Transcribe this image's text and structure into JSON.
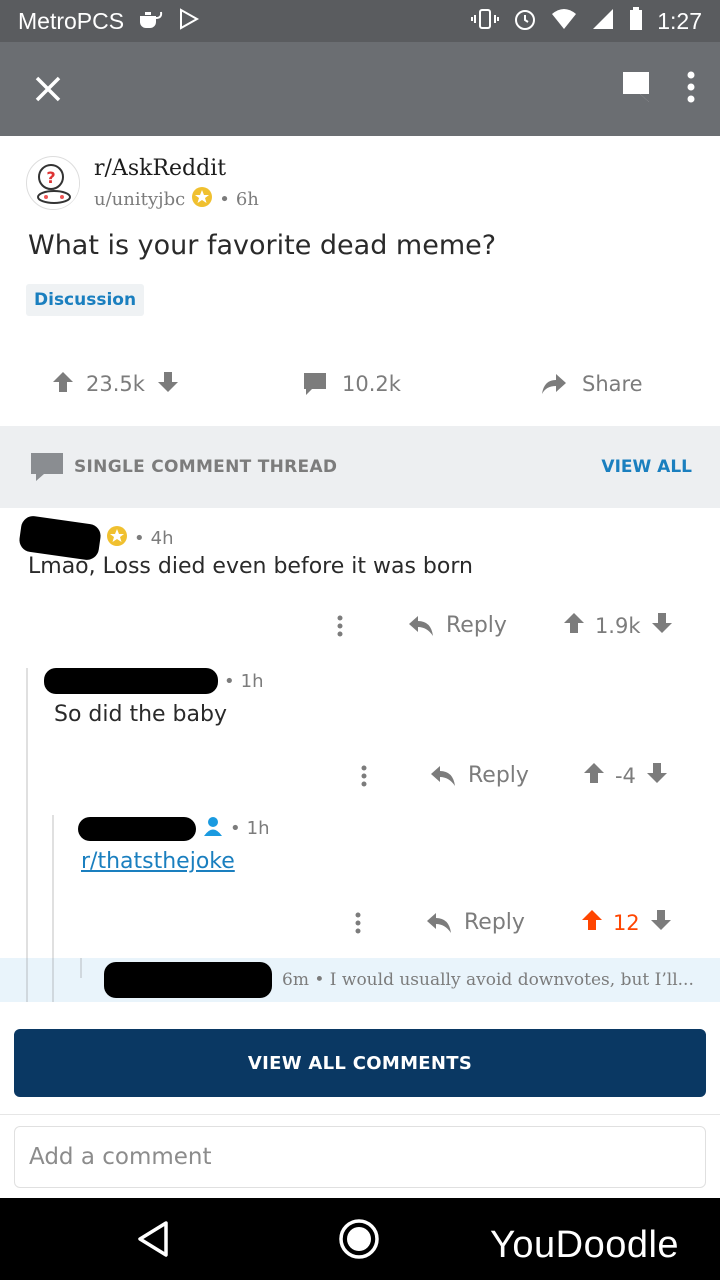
{
  "status_bar": {
    "carrier": "MetroPCS",
    "time": "1:27"
  },
  "post": {
    "subreddit": "r/AskReddit",
    "author": "u/unityjbc",
    "age": "6h",
    "title": "What is your favorite dead meme?",
    "flair": "Discussion",
    "score": "23.5k",
    "comment_count": "10.2k",
    "share_label": "Share"
  },
  "thread_header": {
    "label": "SINGLE COMMENT THREAD",
    "view_all": "VIEW ALL"
  },
  "comments": [
    {
      "age": "4h",
      "body": "Lmao, Loss died even before it was born",
      "reply_label": "Reply",
      "score": "1.9k"
    },
    {
      "age": "1h",
      "body": "So did the baby",
      "reply_label": "Reply",
      "score": "-4"
    },
    {
      "age": "1h",
      "body": "r/thatsthejoke",
      "reply_label": "Reply",
      "score": "12"
    }
  ],
  "collapsed_comment": {
    "age": "6m",
    "preview": "I would usually avoid downvotes, but I’ll..."
  },
  "view_all_comments": "VIEW ALL COMMENTS",
  "add_comment_placeholder": "Add a comment",
  "watermark": "YouDoodle",
  "colors": {
    "upvoted": "#ff4500",
    "link": "#1a7fbf",
    "button_bg": "#0a3863"
  }
}
